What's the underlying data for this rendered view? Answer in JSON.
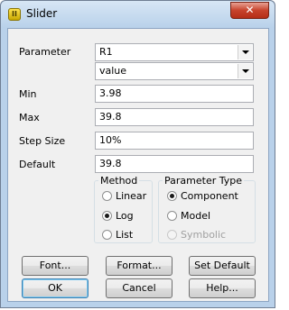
{
  "window": {
    "title": "Slider",
    "close_label": "✕",
    "icon_glyph": "II"
  },
  "form": {
    "parameter_label": "Parameter",
    "parameter_value": "R1",
    "property_value": "value",
    "min_label": "Min",
    "min_value": "3.98",
    "max_label": "Max",
    "max_value": "39.8",
    "step_label": "Step Size",
    "step_value": "10%",
    "default_label": "Default",
    "default_value": "39.8"
  },
  "method": {
    "legend": "Method",
    "options": [
      {
        "label": "Linear",
        "checked": false
      },
      {
        "label": "Log",
        "checked": true
      },
      {
        "label": "List",
        "checked": false
      }
    ]
  },
  "parameter_type": {
    "legend": "Parameter Type",
    "options": [
      {
        "label": "Component",
        "checked": true
      },
      {
        "label": "Model",
        "checked": false
      },
      {
        "label": "Symbolic",
        "checked": false,
        "disabled": true
      }
    ]
  },
  "buttons": {
    "font": "Font...",
    "format": "Format...",
    "set_default": "Set Default",
    "ok": "OK",
    "cancel": "Cancel",
    "help": "Help..."
  }
}
